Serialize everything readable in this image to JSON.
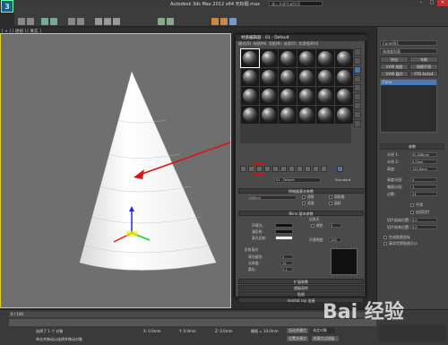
{
  "app": {
    "logo": "3",
    "title": "Autodesk 3ds Max  2012 x64   无标题.max",
    "search_placeholder": "键入关键字或短语",
    "win_min": "–",
    "win_max": "□",
    "win_close": "✕"
  },
  "viewport": {
    "label": "[ + ] [ 透视 ] [ 真实 ]"
  },
  "material_editor": {
    "title": "材质编辑器 - 01 - Default",
    "menu": "模式(D)  材质(M)  导航(N)  选项(O)  实用程序(U)",
    "material_name": "01 - Default",
    "type_button": "Standard",
    "section_shader": "明暗器基本参数",
    "shader_type": "(B)Blinn",
    "cb_wire": "线框",
    "cb_2side": "双面",
    "cb_facemap": "面贴图",
    "cb_faceted": "面状",
    "section_blinn": "Blinn 基本参数",
    "self_illum": "自发光",
    "color_label": "颜色",
    "color_value": "0",
    "ambient": "环境光:",
    "diffuse": "漫反射:",
    "specular": "高光反射:",
    "opacity_label": "不透明度:",
    "opacity_value": "100",
    "spec_highlights": "反射高光",
    "spec_level": "高光级别:",
    "spec_level_value": "0",
    "glossiness": "光泽度:",
    "gloss_value": "10",
    "soften": "柔化:",
    "soften_value": "0.1",
    "rollouts": [
      "扩展参数",
      "超级采样",
      "贴图",
      "mental ray 连接"
    ]
  },
  "right_panel": {
    "object_name": "Cone001",
    "modifier_list": "修改器列表",
    "buttons": [
      "挤出",
      "车削",
      "UVW 贴图",
      "网格平滑",
      "UVW 展开",
      "FFD 4x4x4"
    ],
    "stack_item": "Cone",
    "section_params": "参数",
    "params": [
      {
        "label": "半径 1:",
        "value": "50.508mm"
      },
      {
        "label": "半径 2:",
        "value": "0.0mm"
      },
      {
        "label": "高度:",
        "value": "120.0mm"
      },
      {
        "label": "高度分段:",
        "value": "5"
      },
      {
        "label": "端面分段:",
        "value": "1"
      },
      {
        "label": "边数:",
        "value": "24"
      }
    ],
    "cb_smooth": "平滑",
    "cb_slice": "启用切片",
    "slice_from": "切片起始位置:",
    "slice_to": "切片结束位置:",
    "slice_from_value": "0.0",
    "slice_to_value": "0.0",
    "cb_mapping": "生成贴图坐标",
    "cb_realworld": "真实世界贴图大小"
  },
  "status": {
    "frame": "0 / 100",
    "selected": "选择了 1 个 对象",
    "hint": "单击并拖动以选择并移动对象",
    "x": "X: 0.0mm",
    "y": "Y: 0.0mm",
    "z": "Z: 0.0mm",
    "grid": "栅格 = 10.0mm",
    "autokey": "自动关键点",
    "setkey": "设置关键点",
    "selected_obj": "选定对象",
    "keyfilter": "关键点过滤器...",
    "watermark": "Bai 经验"
  }
}
